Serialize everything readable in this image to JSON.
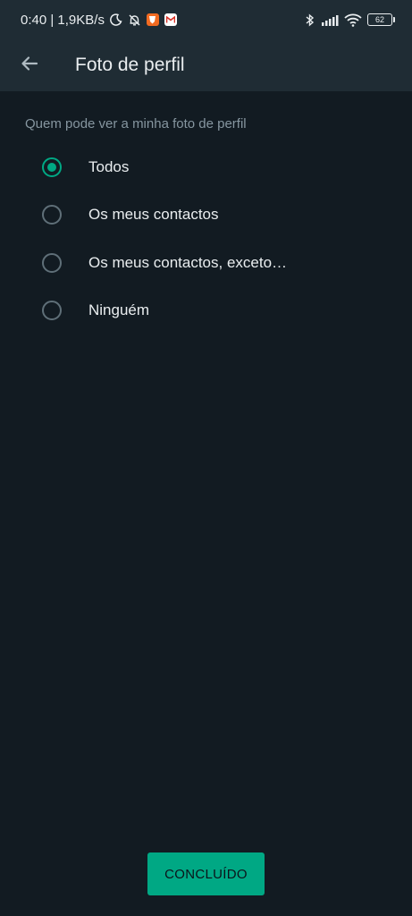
{
  "status_bar": {
    "time_speed": "0:40 | 1,9KB/s",
    "battery": "62",
    "icons": [
      "moon-icon",
      "bell-off-icon",
      "brave-app-icon",
      "gmail-app-icon",
      "bluetooth-icon",
      "signal-icon",
      "wifi-icon",
      "battery-icon"
    ]
  },
  "header": {
    "title": "Foto de perfil",
    "back_icon": "arrow-left-icon"
  },
  "section_label": "Quem pode ver a minha foto de perfil",
  "options": [
    {
      "label": "Todos",
      "selected": true
    },
    {
      "label": "Os meus contactos",
      "selected": false
    },
    {
      "label": "Os meus contactos, exceto…",
      "selected": false
    },
    {
      "label": "Ninguém",
      "selected": false
    }
  ],
  "done_button": "CONCLUÍDO",
  "colors": {
    "background": "#121b22",
    "appbar": "#1f2c34",
    "accent": "#00a884",
    "secondary_text": "#8696a0"
  }
}
